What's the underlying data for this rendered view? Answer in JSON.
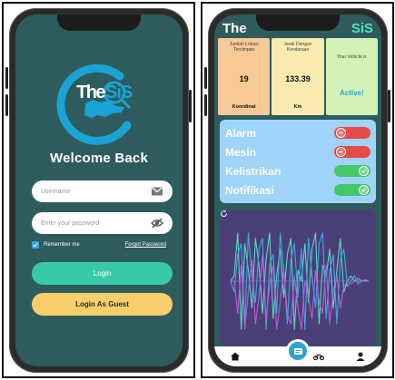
{
  "login": {
    "logo_text": "TheSiS",
    "welcome": "Welcome Back",
    "username_placeholder": "Username",
    "password_placeholder": "Enter your password",
    "remember_label": "Remember me",
    "remember_checked": true,
    "forgot_label": "Forgot Password",
    "login_button": "Login",
    "guest_button": "Login As Guest",
    "icons": {
      "username": "mail-icon",
      "password": "eye-off-icon"
    },
    "colors": {
      "background": "#2e5b5d",
      "login_button": "#38c9a6",
      "guest_button": "#f8cf6a",
      "logo": "#1aa3d4"
    }
  },
  "dashboard": {
    "title_left": "The",
    "title_right": "SiS",
    "stats": [
      {
        "label": "Jumlah Lokasi Tersimpan",
        "value": "19",
        "unit": "Koordinat"
      },
      {
        "label": "Jarak Dengan Kendaraan",
        "value": "133.39",
        "unit": "Km"
      },
      {
        "label": "Your Vehicle is",
        "value": "Active!",
        "unit": ""
      }
    ],
    "toggles": [
      {
        "label": "Alarm",
        "state": "off"
      },
      {
        "label": "Mesin",
        "state": "off"
      },
      {
        "label": "Kelistrikan",
        "state": "on"
      },
      {
        "label": "Notifikasi",
        "state": "on"
      }
    ],
    "nav": [
      "home-icon",
      "dashboard-icon",
      "motorcycle-icon",
      "profile-icon"
    ],
    "nav_active": "dashboard-icon",
    "colors": {
      "stat_1": "#f8c995",
      "stat_2": "#fbeab0",
      "stat_3": "#d3f2b7",
      "toggle_panel": "#9fd3f7",
      "chart_panel": "#4a3f77",
      "switch_off": "#e84a48",
      "switch_on": "#44c768"
    }
  },
  "chart_data": {
    "type": "line",
    "title": "",
    "xlabel": "",
    "ylabel": "",
    "ylim": [
      -1,
      1
    ],
    "grid": false,
    "x": [
      0,
      1,
      2,
      3,
      4,
      5,
      6,
      7,
      8,
      9,
      10,
      11,
      12,
      13,
      14,
      15,
      16,
      17,
      18,
      19,
      20,
      21,
      22,
      23,
      24,
      25,
      26,
      27,
      28,
      29,
      30,
      31,
      32,
      33,
      34,
      35,
      36,
      37,
      38,
      39
    ],
    "series": [
      {
        "color": "#5ad7c2",
        "values": [
          0.0,
          0.1,
          0.9,
          -0.9,
          0.7,
          0.2,
          -0.5,
          0.8,
          0.3,
          -0.6,
          0.4,
          0.9,
          -0.7,
          0.1,
          0.6,
          -0.3,
          0.5,
          0.8,
          -0.9,
          0.2,
          0.0,
          0.7,
          -0.4,
          0.6,
          0.9,
          -0.8,
          0.3,
          0.1,
          0.6,
          -0.5,
          0.2,
          0.8,
          -0.2,
          0.0,
          0.1,
          0.0,
          0.05,
          0.0,
          0.02,
          0.0
        ]
      },
      {
        "color": "#3fa7e6",
        "values": [
          0.0,
          -0.2,
          0.5,
          0.7,
          -0.8,
          0.9,
          0.1,
          -0.4,
          0.6,
          0.8,
          -0.9,
          0.3,
          0.5,
          -0.6,
          0.9,
          0.2,
          -0.8,
          0.4,
          0.7,
          -0.3,
          0.6,
          -0.9,
          0.8,
          0.1,
          -0.5,
          0.7,
          0.9,
          -0.7,
          0.2,
          0.5,
          -0.8,
          0.4,
          0.6,
          -0.1,
          0.0,
          0.1,
          -0.05,
          0.0,
          0.0,
          0.0
        ]
      },
      {
        "color": "#b45fd6",
        "values": [
          0.0,
          0.0,
          -0.6,
          0.3,
          -0.9,
          -0.2,
          0.4,
          -0.8,
          -0.3,
          0.5,
          -0.7,
          -0.1,
          0.3,
          -0.9,
          -0.4,
          0.2,
          -0.6,
          -0.8,
          0.1,
          -0.5,
          -0.9,
          0.0,
          -0.3,
          -0.7,
          0.2,
          -0.4,
          -0.6,
          0.3,
          -0.8,
          -0.2,
          0.1,
          -0.5,
          -0.1,
          0.0,
          -0.05,
          0.0,
          0.0,
          0.0,
          0.0,
          0.0
        ]
      }
    ]
  }
}
